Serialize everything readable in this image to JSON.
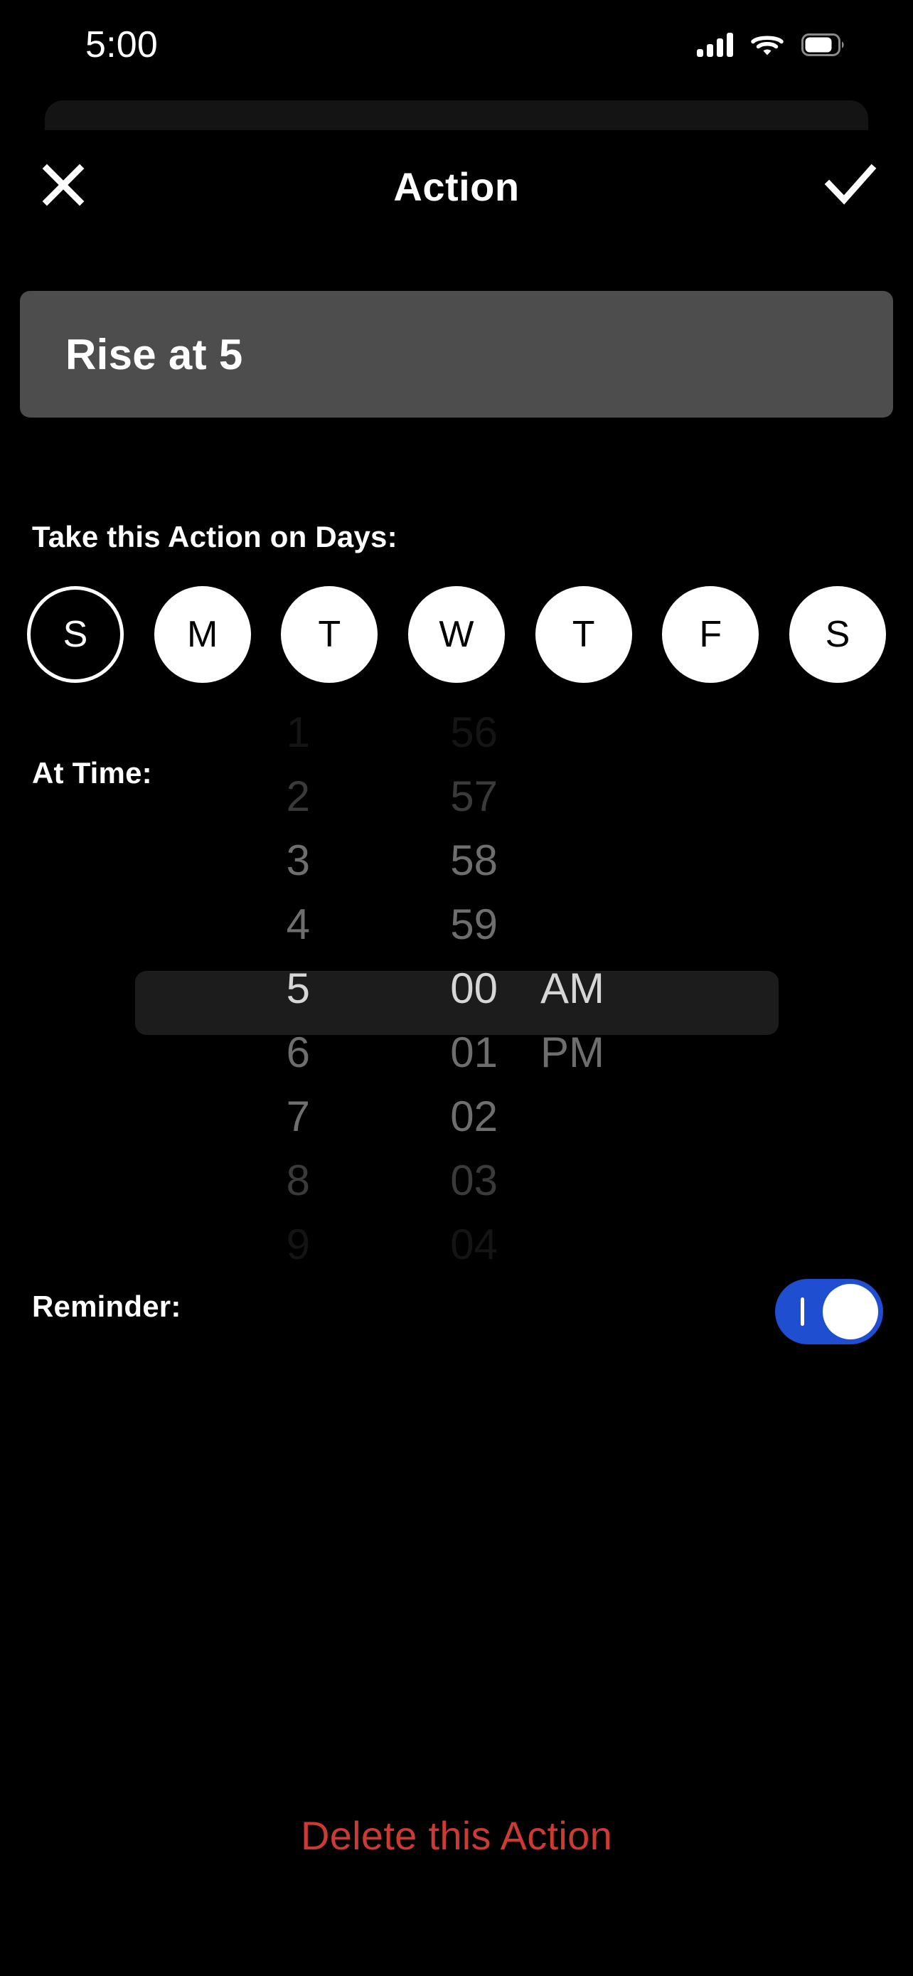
{
  "status_bar": {
    "time": "5:00",
    "cellular_icon": "cellular-signal-icon",
    "wifi_icon": "wifi-icon",
    "battery_icon": "battery-icon"
  },
  "header": {
    "title": "Action",
    "close_icon": "close-x-icon",
    "confirm_icon": "checkmark-icon"
  },
  "title_field": {
    "value": "Rise at 5",
    "placeholder": "Rise at 5"
  },
  "days": {
    "label": "Take this Action on Days:",
    "items": [
      {
        "label": "S",
        "name": "sunday",
        "selected": false
      },
      {
        "label": "M",
        "name": "monday",
        "selected": true
      },
      {
        "label": "T",
        "name": "tuesday",
        "selected": true
      },
      {
        "label": "W",
        "name": "wednesday",
        "selected": true
      },
      {
        "label": "T",
        "name": "thursday",
        "selected": true
      },
      {
        "label": "F",
        "name": "friday",
        "selected": true
      },
      {
        "label": "S",
        "name": "saturday",
        "selected": true
      }
    ]
  },
  "time": {
    "label": "At Time:",
    "selected_hour": "5",
    "selected_minute": "00",
    "selected_period": "AM",
    "hours": [
      "1",
      "2",
      "3",
      "4",
      "5",
      "6",
      "7",
      "8",
      "9"
    ],
    "minutes": [
      "56",
      "57",
      "58",
      "59",
      "00",
      "01",
      "02",
      "03",
      "04"
    ],
    "periods": [
      "AM",
      "PM"
    ]
  },
  "reminder": {
    "label": "Reminder:",
    "enabled": true,
    "toggle_on_color": "#1f4ed0",
    "toggle_knob_color": "#ffffff"
  },
  "delete": {
    "label": "Delete this Action",
    "color": "#cc3b33"
  },
  "theme": {
    "background": "#000000",
    "field_background": "#4d4d4d",
    "picker_highlight": "#1c1c1c",
    "text": "#ffffff"
  }
}
